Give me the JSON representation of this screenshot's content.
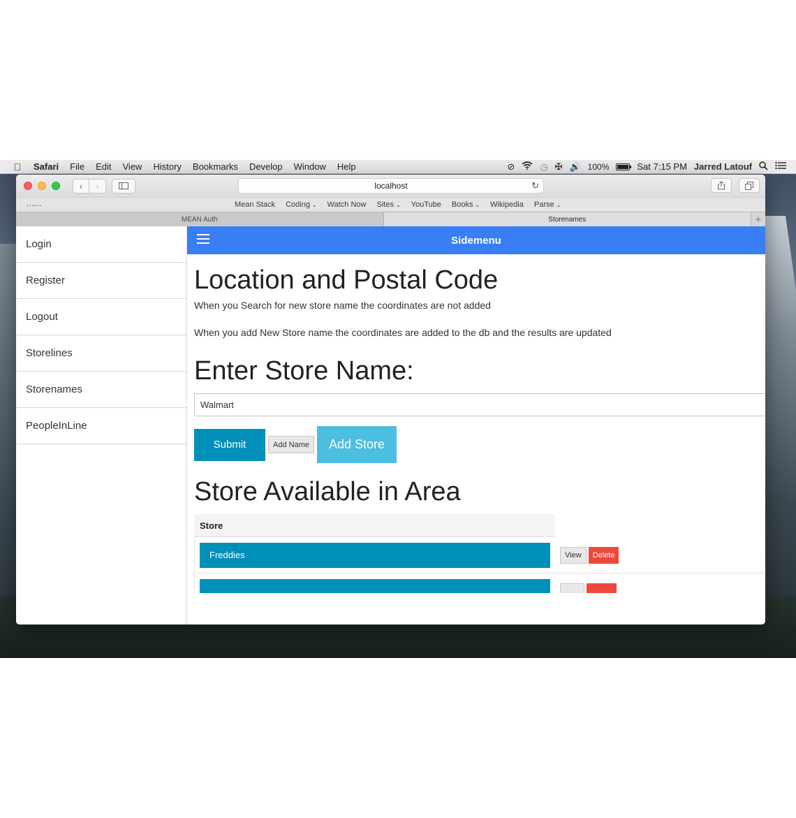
{
  "menubar": {
    "app_name": "Safari",
    "menus": [
      "File",
      "Edit",
      "View",
      "History",
      "Bookmarks",
      "Develop",
      "Window",
      "Help"
    ],
    "battery": "100%",
    "clock": "Sat 7:15 PM",
    "user": "Jarred Latouf"
  },
  "browser": {
    "url": "localhost",
    "bookmarks": [
      {
        "label": "Mean Stack",
        "dropdown": false
      },
      {
        "label": "Coding",
        "dropdown": true
      },
      {
        "label": "Watch Now",
        "dropdown": false
      },
      {
        "label": "Sites",
        "dropdown": true
      },
      {
        "label": "YouTube",
        "dropdown": false
      },
      {
        "label": "Books",
        "dropdown": true
      },
      {
        "label": "Wikipedia",
        "dropdown": false
      },
      {
        "label": "Parse",
        "dropdown": true
      }
    ],
    "tabs": [
      {
        "label": "MEAN Auth",
        "active": false
      },
      {
        "label": "Storenames",
        "active": true
      }
    ]
  },
  "sidemenu": {
    "items": [
      "Login",
      "Register",
      "Logout",
      "Storelines",
      "Storenames",
      "PeopleInLine"
    ]
  },
  "header": {
    "title": "Sidemenu"
  },
  "main": {
    "heading1": "Location and Postal Code",
    "para1": "When you Search for new store name the coordinates are not added",
    "para2": "When you add New Store name the coordinates are added to the db and the results are updated",
    "heading2": "Enter Store Name:",
    "store_input_value": "Walmart",
    "submit_label": "Submit",
    "add_name_label": "Add Name",
    "add_store_label": "Add Store",
    "heading3": "Store Available in Area",
    "table_header": "Store",
    "rows": [
      {
        "store": "Freddies",
        "view_label": "View",
        "delete_label": "Delete"
      },
      {
        "store": "",
        "view_label": "",
        "delete_label": ""
      }
    ]
  },
  "colors": {
    "header_bar": "#387ef5",
    "primary_button": "#008fb9",
    "add_store_button": "#4cbedf",
    "delete_button": "#ef473a"
  }
}
